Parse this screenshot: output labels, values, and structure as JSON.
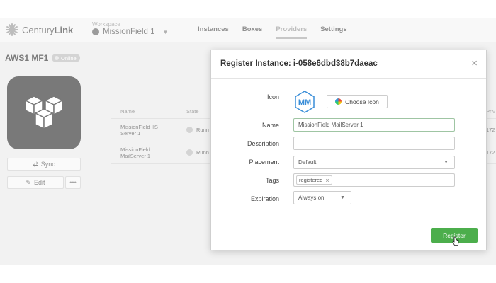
{
  "topbar": {
    "logo_text_light": "Century",
    "logo_text_bold": "Link",
    "workspace_label": "Workspace",
    "workspace_name": "MissionField 1",
    "nav": [
      "Instances",
      "Boxes",
      "Providers",
      "Settings"
    ],
    "active_nav": "Providers"
  },
  "page": {
    "title": "AWS1 MF1",
    "status": "Online",
    "sync_label": "Sync",
    "edit_label": "Edit",
    "more_label": "•••"
  },
  "table": {
    "headers": {
      "name": "Name",
      "state": "State",
      "private": "Priv"
    },
    "rows": [
      {
        "name_line1": "MissionField IIS",
        "name_line2": "Server 1",
        "state": "Runn",
        "private": "172"
      },
      {
        "name_line1": "MissionField",
        "name_line2": "MailServer 1",
        "state": "Runn",
        "private": "172"
      }
    ]
  },
  "modal": {
    "title": "Register Instance: i-058e6dbd38b7daeac",
    "close": "×",
    "labels": {
      "icon": "Icon",
      "name": "Name",
      "description": "Description",
      "placement": "Placement",
      "tags": "Tags",
      "expiration": "Expiration"
    },
    "icon_initials": "MM",
    "choose_icon_label": "Choose Icon",
    "name_value": "MissionField MailServer 1",
    "description_value": "",
    "placement_value": "Default",
    "tag_value": "registered",
    "tag_remove": "×",
    "expiration_value": "Always on",
    "register_label": "Register"
  },
  "colors": {
    "accent_green": "#4cae4c",
    "icon_blue": "#3a8ed8",
    "tile_dark": "#323232"
  }
}
